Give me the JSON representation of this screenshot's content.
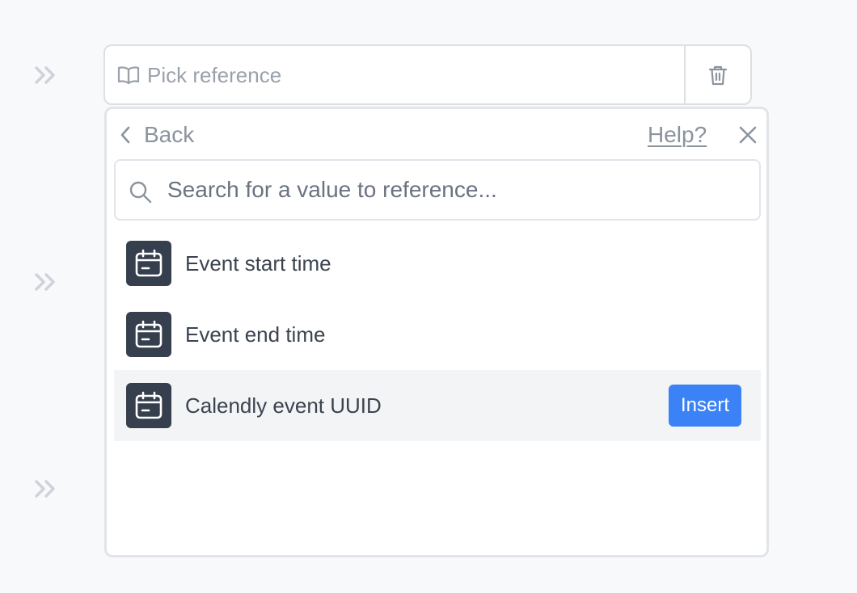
{
  "picker": {
    "placeholder": "Pick reference",
    "icon": "book-open-icon",
    "delete_icon": "trash-icon"
  },
  "row_handles": [
    "chevrons-right-icon",
    "chevrons-right-icon",
    "chevrons-right-icon"
  ],
  "dropdown": {
    "back_label": "Back",
    "help_label": "Help?",
    "close_icon": "close-icon",
    "search": {
      "placeholder": "Search for a value to reference...",
      "value": "",
      "icon": "search-icon"
    },
    "items": [
      {
        "label": "Event start time",
        "icon": "calendar-icon",
        "active": false
      },
      {
        "label": "Event end time",
        "icon": "calendar-icon",
        "active": false
      },
      {
        "label": "Calendly event UUID",
        "icon": "calendar-icon",
        "active": true,
        "action_label": "Insert"
      }
    ]
  },
  "colors": {
    "accent": "#3b82f6",
    "icon_tile": "#363f4d",
    "hover_row": "#f2f4f6"
  }
}
